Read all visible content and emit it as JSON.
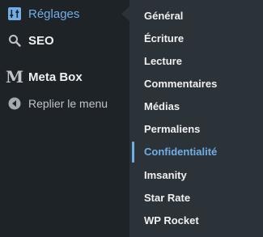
{
  "sidebar": {
    "items": [
      {
        "label": "Réglages",
        "icon": "settings-icon"
      },
      {
        "label": "SEO",
        "icon": "search-icon"
      },
      {
        "label": "Meta Box",
        "icon": "metabox-logo-icon",
        "glyph": "M"
      },
      {
        "label": "Replier le menu",
        "icon": "collapse-arrow-icon"
      }
    ]
  },
  "submenu": {
    "items": [
      {
        "label": "Général"
      },
      {
        "label": "Écriture"
      },
      {
        "label": "Lecture"
      },
      {
        "label": "Commentaires"
      },
      {
        "label": "Médias"
      },
      {
        "label": "Permaliens"
      },
      {
        "label": "Confidentialité",
        "active": true
      },
      {
        "label": "Imsanity"
      },
      {
        "label": "Star Rate"
      },
      {
        "label": "WP Rocket"
      }
    ]
  },
  "colors": {
    "sidebar_bg": "#1d2327",
    "submenu_bg": "#2c3338",
    "accent": "#72aee6",
    "text": "#f0f0f1"
  }
}
